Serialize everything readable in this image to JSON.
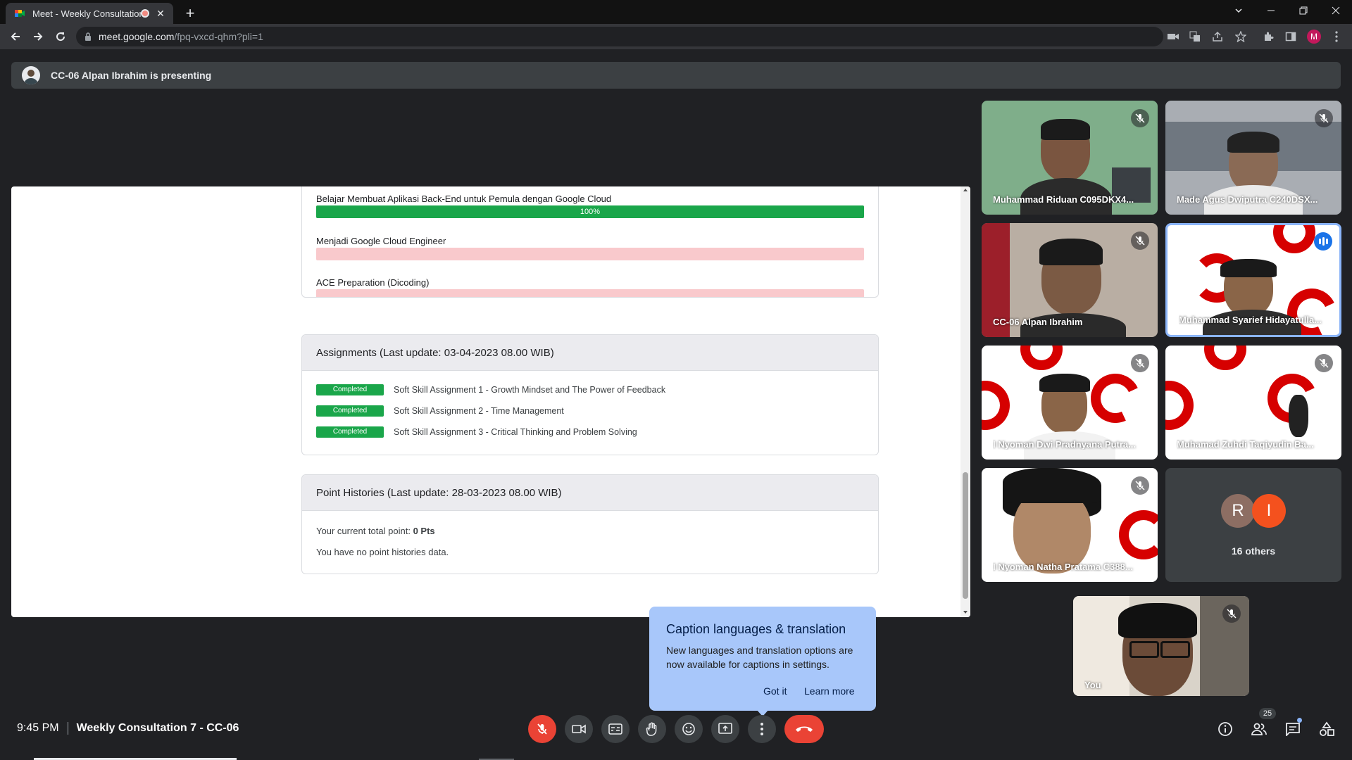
{
  "browser": {
    "tab_title": "Meet - Weekly Consultation",
    "url_host": "meet.google.com",
    "url_path": "/fpq-vxcd-qhm?pli=1",
    "profile_initial": "M"
  },
  "banner": {
    "presenting_text": "CC-06 Alpan Ibrahim is presenting"
  },
  "shared_screen": {
    "courses": [
      {
        "name": "Belajar Membuat Aplikasi Back-End untuk Pemula dengan Google Cloud",
        "progress_label": "100%",
        "progress": 1.0
      },
      {
        "name": "Menjadi Google Cloud Engineer",
        "progress_label": "",
        "progress": 0
      },
      {
        "name": "ACE Preparation (Dicoding)",
        "progress_label": "",
        "progress": 0
      }
    ],
    "assignments": {
      "header": "Assignments (Last update: 03-04-2023 08.00 WIB)",
      "items": [
        {
          "status": "Completed",
          "title": "Soft Skill Assignment 1 - Growth Mindset and The Power of Feedback"
        },
        {
          "status": "Completed",
          "title": "Soft Skill Assignment 2 - Time Management"
        },
        {
          "status": "Completed",
          "title": "Soft Skill Assignment 3 - Critical Thinking and Problem Solving"
        }
      ]
    },
    "points": {
      "header": "Point Histories (Last update: 28-03-2023 08.00 WIB)",
      "total_label": "Your current total point: ",
      "total_value": "0 Pts",
      "empty_text": "You have no point histories data."
    }
  },
  "participants": [
    {
      "name": "Muhammad Riduan C095DKX4...",
      "muted": true
    },
    {
      "name": "Made Agus Dwiputra C240DSX...",
      "muted": true
    },
    {
      "name": "CC-06 Alpan Ibrahim",
      "muted": true
    },
    {
      "name": "Muhammad Syarief Hidayatulla...",
      "speaking": true
    },
    {
      "name": "I Nyoman Dwi Pradnyana Putra...",
      "muted": true
    },
    {
      "name": "Muhamad Zuhdi Taqiyudin Ba...",
      "muted": true
    },
    {
      "name": "I Nyoman Natha Pratama C388...",
      "muted": true
    }
  ],
  "others_tile": {
    "avatars": [
      "R",
      "I"
    ],
    "label": "16 others"
  },
  "self_tile": {
    "name": "You",
    "muted": true
  },
  "caption_popup": {
    "title": "Caption languages & translation",
    "body": "New languages and translation options are now available for captions in settings.",
    "got_it": "Got it",
    "learn_more": "Learn more"
  },
  "bottom_bar": {
    "time": "9:45 PM",
    "meeting_title": "Weekly Consultation 7 - CC-06",
    "participant_count": "25"
  },
  "colors": {
    "meet_bg": "#202124",
    "progress_green": "#1aa64a",
    "progress_empty": "#f9c9cc",
    "end_call_red": "#ea4335",
    "popup_blue": "#a8c7fa"
  }
}
